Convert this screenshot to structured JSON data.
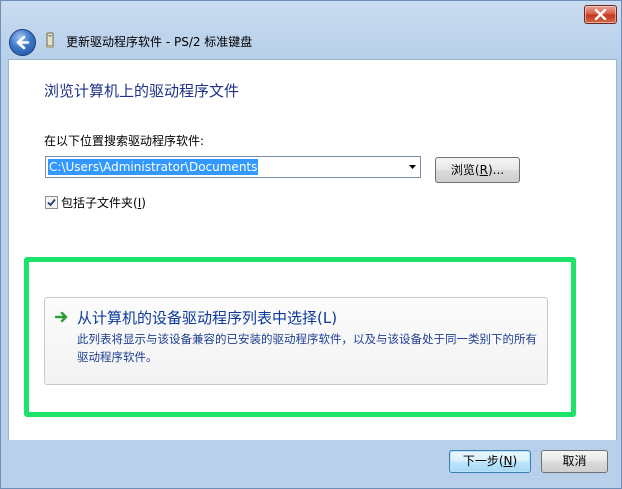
{
  "window": {
    "title": "更新驱动程序软件 - PS/2 标准键盘",
    "close_icon": "close-icon",
    "back_icon": "back-arrow-icon",
    "title_icon": "keyboard-device-icon"
  },
  "main": {
    "heading": "浏览计算机上的驱动程序文件",
    "search_label": "在以下位置搜索驱动程序软件:",
    "path_value": "C:\\Users\\Administrator\\Documents",
    "browse_label_pre": "浏览(",
    "browse_label_key": "R",
    "browse_label_post": ")...",
    "include_subfolders_checked": true,
    "include_subfolders_label_pre": "包括子文件夹(",
    "include_subfolders_label_key": "I",
    "include_subfolders_label_post": ")"
  },
  "choose_option": {
    "title": "从计算机的设备驱动程序列表中选择(L)",
    "description": "此列表将显示与该设备兼容的已安装的驱动程序软件，以及与该设备处于同一类别下的所有驱动程序软件。",
    "arrow_icon": "green-arrow-icon",
    "highlight_color": "#1ee36a"
  },
  "footer": {
    "next_label_pre": "下一步(",
    "next_label_key": "N",
    "next_label_post": ")",
    "cancel_label": "取消"
  }
}
